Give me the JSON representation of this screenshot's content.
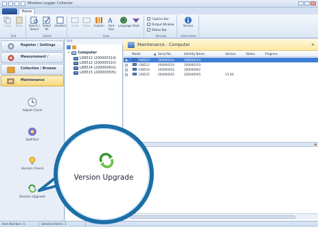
{
  "window": {
    "title": "Wireless Logger Collector"
  },
  "ribbon": {
    "tab_home": "Home",
    "groups": [
      {
        "label": "Edit",
        "buttons": [
          "Copy",
          "Paste"
        ]
      },
      {
        "label": "Select",
        "buttons": [
          "Search / Select",
          "Select All",
          "Unselect"
        ]
      },
      {
        "label": "View",
        "buttons": [
          "Undo",
          "Redo",
          "Column",
          "Font Size",
          "Language",
          "Style"
        ]
      },
      {
        "label": "Window",
        "checks": [
          "Caption Bar",
          "Output Window",
          "Status Bar"
        ]
      },
      {
        "label": "Information",
        "buttons": [
          "Version"
        ]
      }
    ]
  },
  "nav": {
    "buttons": [
      {
        "label": "Register / Settings"
      },
      {
        "label": "Measurement / Monitoring"
      },
      {
        "label": "Collection / Browse"
      },
      {
        "label": "Maintenance",
        "active": true
      }
    ],
    "items": [
      {
        "label": "Adjust Clock"
      },
      {
        "label": "Self-Test"
      },
      {
        "label": "Version Check"
      },
      {
        "label": "Version Upgrade"
      }
    ]
  },
  "tree": {
    "header": "Unit",
    "root": "Computer",
    "devices": [
      "LR8512 (200000314)",
      "LR8512 (200000310)",
      "LR8514 (200000402)",
      "LR8515 (200000505)"
    ]
  },
  "main": {
    "header": "Maintenance : Computer",
    "columns": [
      "Model",
      "Serial No.",
      "Identity Name",
      "Version",
      "Status",
      "Progress"
    ],
    "rows": [
      {
        "model": "LR8512",
        "serial": "200000314",
        "identity": "200000314",
        "version": "",
        "status": "",
        "progress": "",
        "selected": true
      },
      {
        "model": "LR8512",
        "serial": "200000310",
        "identity": "200000310",
        "version": "",
        "status": "",
        "progress": ""
      },
      {
        "model": "LR8514",
        "serial": "200000402",
        "identity": "200000402",
        "version": "",
        "status": "",
        "progress": ""
      },
      {
        "model": "LR8515",
        "serial": "200000505",
        "identity": "200000505",
        "version": "V1.00",
        "status": "",
        "progress": ""
      }
    ]
  },
  "status_bar": {
    "item_number": "Item Number: 4",
    "selected_items": "Selected Items: 1"
  },
  "callout": {
    "label": "Version Upgrade"
  }
}
